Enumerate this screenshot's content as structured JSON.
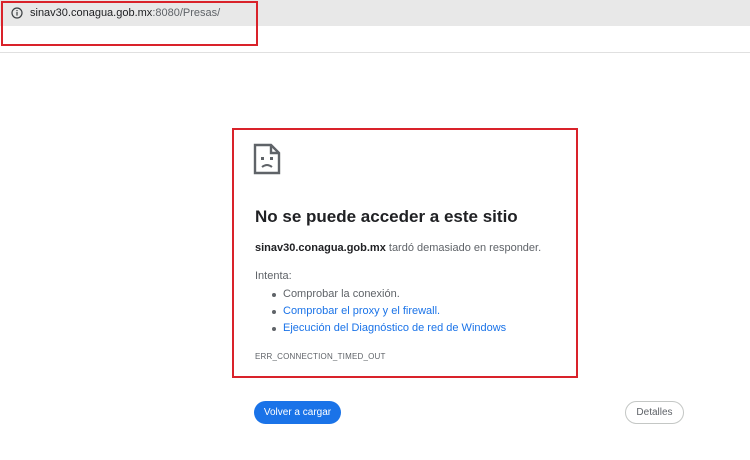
{
  "address_bar": {
    "url_host": "sinav30.conagua.gob.mx",
    "url_rest": ":8080/Presas/",
    "info_icon": "info-icon"
  },
  "error": {
    "icon": "sad-page-icon",
    "title": "No se puede acceder a este sitio",
    "host": "sinav30.conagua.gob.mx",
    "description_suffix": " tardó demasiado en responder.",
    "try_label": "Intenta:",
    "suggestions": [
      "Comprobar la conexión.",
      "Comprobar el proxy y el firewall.",
      "Ejecución del Diagnóstico de red de Windows"
    ],
    "code": "ERR_CONNECTION_TIMED_OUT"
  },
  "buttons": {
    "reload": "Volver a cargar",
    "details": "Detalles"
  },
  "colors": {
    "annotation": "#d9222a",
    "link": "#1a73e8",
    "primary_button": "#1a73e8"
  }
}
